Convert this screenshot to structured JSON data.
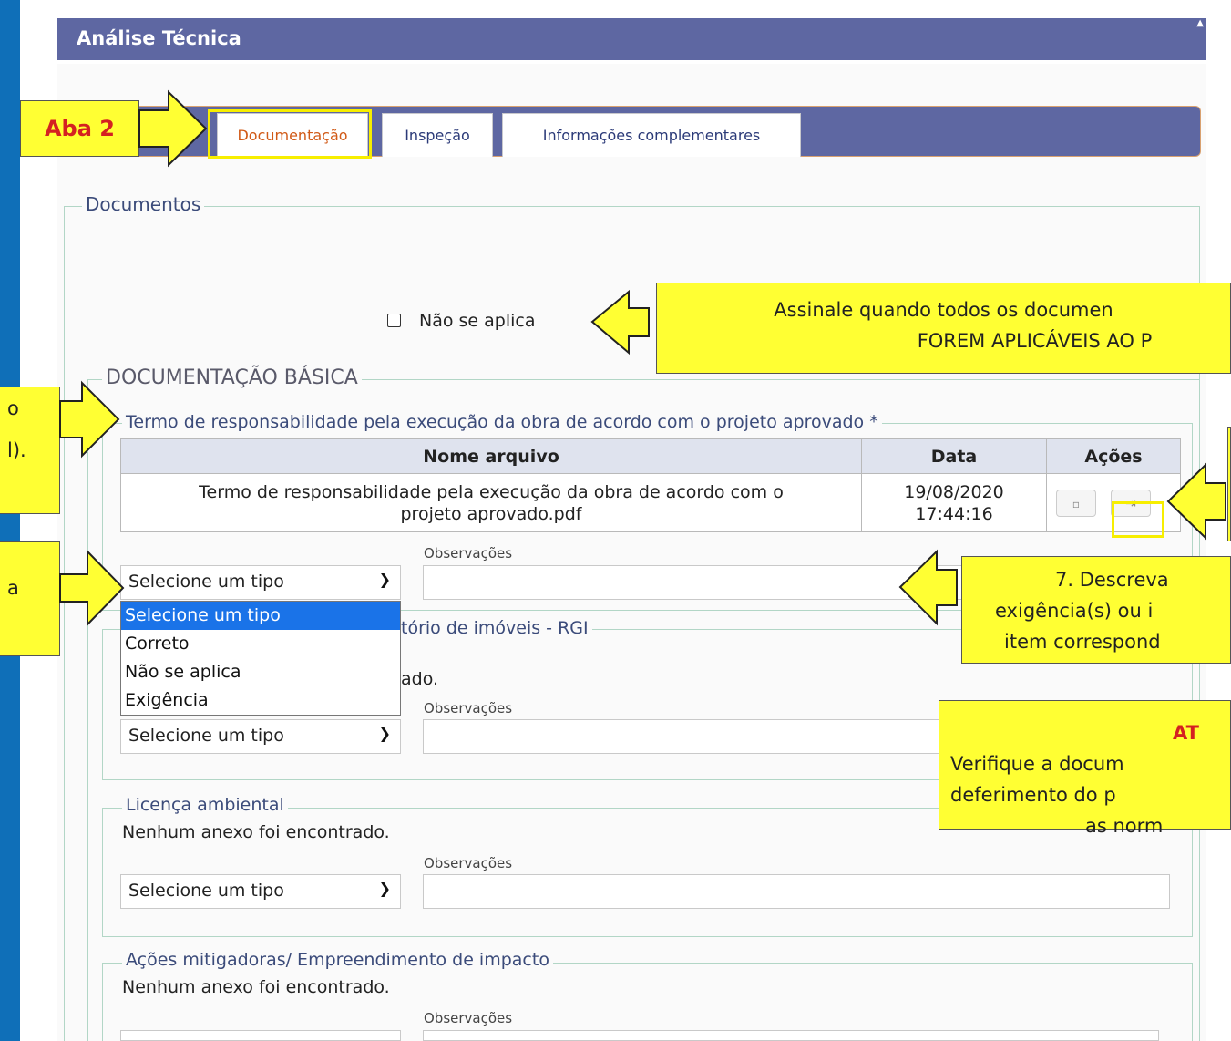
{
  "header": {
    "title": "Análise Técnica"
  },
  "tabs": [
    {
      "label": "Documentação",
      "active": true
    },
    {
      "label": "Inspeção",
      "active": false
    },
    {
      "label": "Informações complementares",
      "active": false
    }
  ],
  "documentos": {
    "legend": "Documentos",
    "nao_se_aplica_label": "Não se aplica",
    "basic_legend": "DOCUMENTAÇÃO BÁSICA",
    "sections": [
      {
        "legend": "Termo de responsabilidade pela execução da obra de acordo com o projeto aprovado *",
        "table": {
          "headers": [
            "Nome arquivo",
            "Data",
            "Ações"
          ],
          "row": {
            "name_line1": "Termo de responsabilidade pela execução da obra de acordo com o",
            "name_line2": "projeto aprovado.pdf",
            "date_line1": "19/08/2020",
            "date_line2": "17:44:16"
          }
        },
        "select_value": "Selecione um tipo",
        "obs_label": "Observações"
      },
      {
        "legend_partial": "tório de imóveis - RGI",
        "empty_partial": "ado.",
        "select_value": "Selecione um tipo",
        "obs_label": "Observações"
      },
      {
        "legend": "Licença ambiental",
        "empty": "Nenhum anexo foi encontrado.",
        "select_value": "Selecione um tipo",
        "obs_label": "Observações"
      },
      {
        "legend": "Ações mitigadoras/ Empreendimento de impacto",
        "empty": "Nenhum anexo foi encontrado.",
        "obs_label": "Observações"
      }
    ],
    "dropdown_options": [
      "Selecione um tipo",
      "Correto",
      "Não se aplica",
      "Exigência"
    ]
  },
  "annotations": {
    "aba2": "Aba 2",
    "assinale_line1": "Assinale quando todos os documen",
    "assinale_line2": "FOREM APLICÁVEIS AO P",
    "left_top_1": "o",
    "left_top_2": "l).",
    "left_mid": "a",
    "descreva_line1": "7. Descreva",
    "descreva_line2": "exigência(s) ou i",
    "descreva_line3": "item correspond",
    "at_title": "AT",
    "at_line1": "Verifique a docum",
    "at_line2": "deferimento do p",
    "at_line3": "as norm"
  },
  "colors": {
    "header": "#5e67a2",
    "annotation": "#ffff33",
    "highlight": "#f7ee00",
    "active_tab": "#d15a17"
  }
}
